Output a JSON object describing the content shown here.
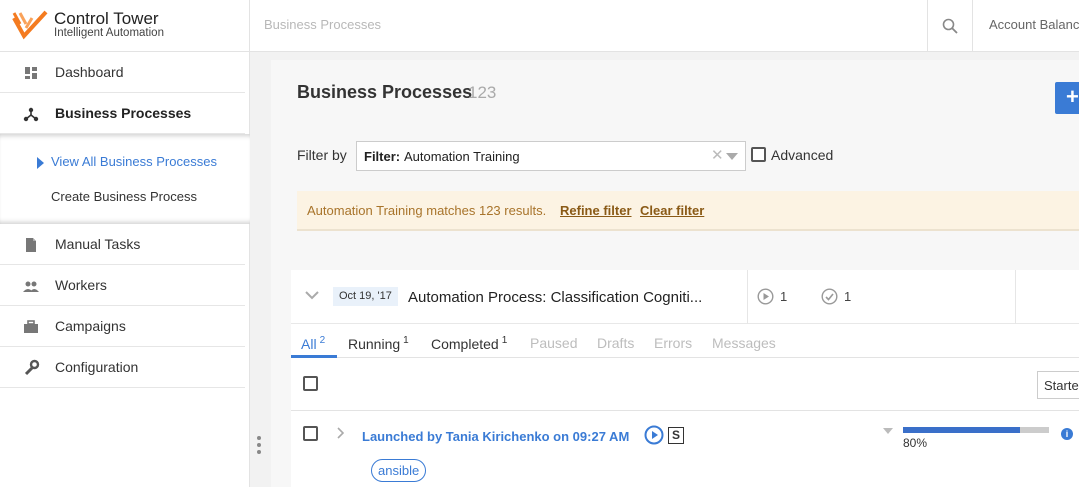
{
  "brand": {
    "title": "Control Tower",
    "subtitle": "Intelligent Automation",
    "accent": "#f47b20"
  },
  "topbar": {
    "breadcrumb": "Business Processes",
    "account": "Account Balanc"
  },
  "sidebar": {
    "items": [
      {
        "label": "Dashboard",
        "icon": "dashboard-icon"
      },
      {
        "label": "Business Processes",
        "icon": "process-icon",
        "active": true
      },
      {
        "label": "Manual Tasks",
        "icon": "document-icon"
      },
      {
        "label": "Workers",
        "icon": "people-icon"
      },
      {
        "label": "Campaigns",
        "icon": "briefcase-icon"
      },
      {
        "label": "Configuration",
        "icon": "wrench-icon"
      }
    ],
    "submenu": [
      {
        "label": "View All Business Processes",
        "selected": true
      },
      {
        "label": "Create Business Process"
      }
    ]
  },
  "page": {
    "title": "Business Processes",
    "count": "123",
    "add_label": "+"
  },
  "filter": {
    "label": "Filter by",
    "key": "Filter:",
    "value": "Automation Training",
    "advanced_label": "Advanced"
  },
  "notice": {
    "message": "Automation Training matches 123 results.",
    "refine": "Refine filter",
    "clear": "Clear filter"
  },
  "process": {
    "date": "Oct 19, '17",
    "title": "Automation Process: Classification Cogniti...",
    "running_count": "1",
    "completed_count": "1",
    "tabs": [
      {
        "label": "All",
        "count": "2",
        "state": "active"
      },
      {
        "label": "Running",
        "count": "1",
        "state": "normal"
      },
      {
        "label": "Completed",
        "count": "1",
        "state": "normal"
      },
      {
        "label": "Paused",
        "count": "",
        "state": "disabled"
      },
      {
        "label": "Drafts",
        "count": "",
        "state": "disabled"
      },
      {
        "label": "Errors",
        "count": "",
        "state": "disabled"
      },
      {
        "label": "Messages",
        "count": "",
        "state": "disabled"
      }
    ],
    "sort_label": "Starte",
    "rows": [
      {
        "launched": "Launched by Tania Kirichenko on 09:27 AM",
        "badge": "S",
        "tag": "ansible",
        "progress": 0.8,
        "progress_label": "80%",
        "info": "i"
      }
    ]
  }
}
